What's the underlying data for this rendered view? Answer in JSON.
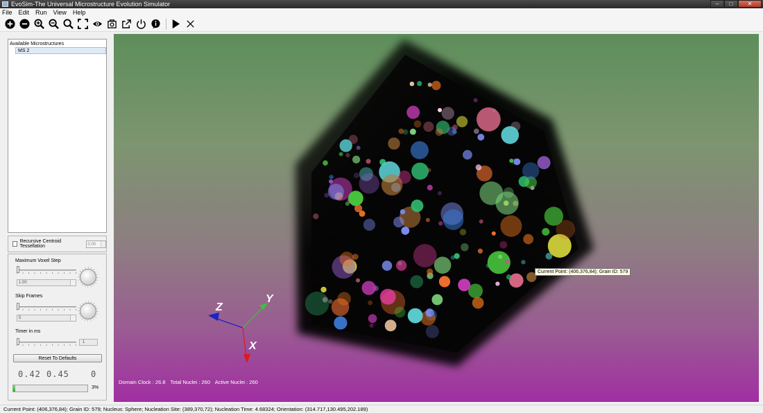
{
  "window": {
    "title": "EvoSim-The Universal Microstructure Evolution Simulator",
    "controls": [
      "–",
      "□",
      "✕"
    ]
  },
  "menu": [
    "File",
    "Edit",
    "Run",
    "View",
    "Help"
  ],
  "toolbar": {
    "icons": [
      "add-icon",
      "remove-icon",
      "zoom-in-icon",
      "zoom-out-icon",
      "search-icon",
      "fullscreen-icon",
      "eye-icon",
      "screenshot-icon",
      "export-icon",
      "power-icon",
      "info-icon",
      "play-icon",
      "stop-icon"
    ]
  },
  "left": {
    "list_header": "Available Microstructures",
    "items": [
      "MS 2"
    ],
    "rct_label": "Recursive Centroid Tessellation",
    "rct_value": "0.00",
    "max_voxel_label": "Maximum Voxel Step",
    "max_voxel_value": "1.00",
    "skip_frames_label": "Skip Frames",
    "skip_frames_value": "5",
    "timer_label": "Timer in ms",
    "timer_value": "1",
    "reset_label": "Reset To Defaults",
    "lcd_a": "0.42",
    "lcd_b": "0.45",
    "lcd_c": "0",
    "progress": 0.03,
    "progress_text": "3%"
  },
  "viewport": {
    "tooltip": "Current Point: (406,376,84); Grain ID: 579",
    "domain_clock": "Domain Clock : 26.8",
    "total_nuclei": "Total Nuclei : 260",
    "active_nuclei": "Active Nuclei : 260",
    "axis_x": "X",
    "axis_y": "Y",
    "axis_z": "Z",
    "colors": {
      "x_axis": "#e01818",
      "y_axis": "#3cc23c",
      "z_axis": "#1a22c8"
    }
  },
  "status": "Current Point: (406,376,84); Grain ID: 579; Nucleus: Sphere; Nucleation Site: (389,370,72); Nucleation Time: 4.68324; Orientation: (314.717,130.495,202.189)"
}
